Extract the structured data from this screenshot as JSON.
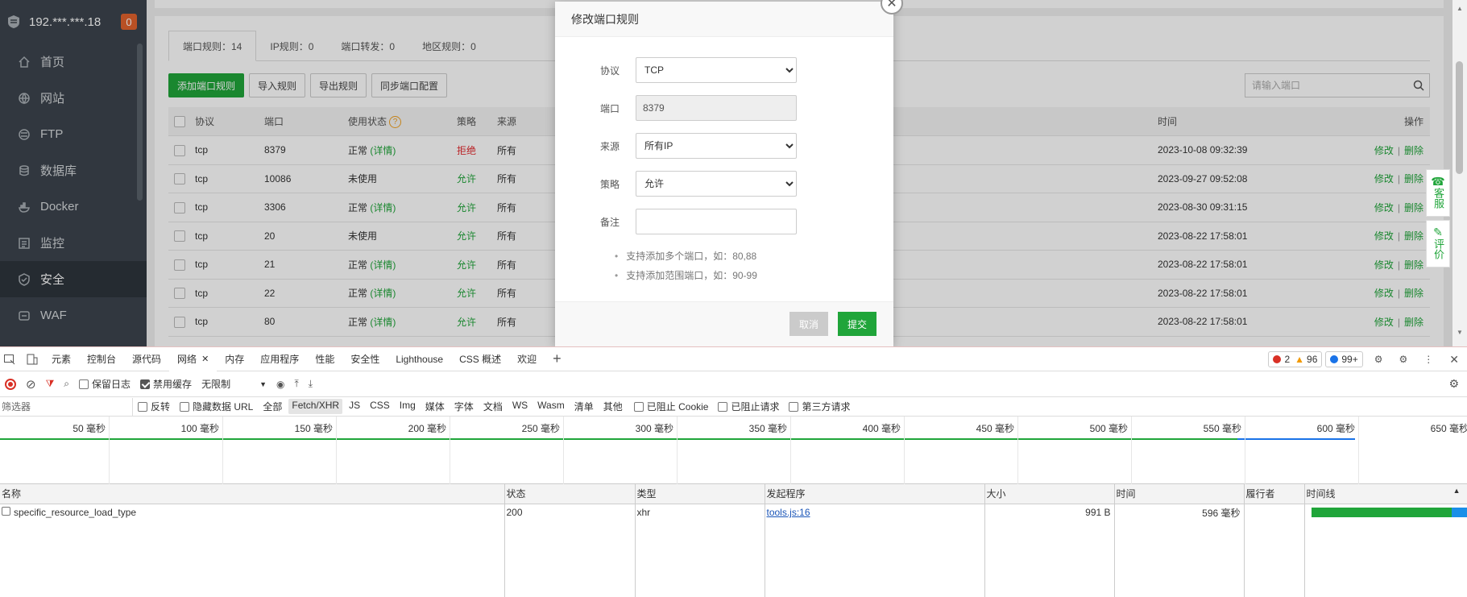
{
  "sidebar": {
    "server_label": "192.***.***.18",
    "badge": "0",
    "items": [
      {
        "label": "首页",
        "icon": "home-icon"
      },
      {
        "label": "网站",
        "icon": "globe-icon"
      },
      {
        "label": "FTP",
        "icon": "ftp-icon"
      },
      {
        "label": "数据库",
        "icon": "database-icon"
      },
      {
        "label": "Docker",
        "icon": "docker-icon"
      },
      {
        "label": "监控",
        "icon": "monitor-icon"
      },
      {
        "label": "安全",
        "icon": "shield-icon"
      },
      {
        "label": "WAF",
        "icon": "waf-icon"
      }
    ]
  },
  "tabs": [
    {
      "label": "端口规则：14"
    },
    {
      "label": "IP规则：0"
    },
    {
      "label": "端口转发：0"
    },
    {
      "label": "地区规则：0"
    }
  ],
  "toolbar": {
    "add_label": "添加端口规则",
    "import_label": "导入规则",
    "export_label": "导出规则",
    "sync_label": "同步端口配置",
    "search_placeholder": "请输入端口"
  },
  "table": {
    "headers": {
      "protocol": "协议",
      "port": "端口",
      "status": "使用状态",
      "policy": "策略",
      "source": "来源",
      "time": "时间",
      "ops": "操作"
    },
    "rows": [
      {
        "protocol": "tcp",
        "port": "8379",
        "status": "正常",
        "detail": "(详情)",
        "policy": "拒绝",
        "source": "所有",
        "time": "2023-10-08 09:32:39"
      },
      {
        "protocol": "tcp",
        "port": "10086",
        "status": "未使用",
        "detail": "",
        "policy": "允许",
        "source": "所有",
        "time": "2023-09-27 09:52:08"
      },
      {
        "protocol": "tcp",
        "port": "3306",
        "status": "正常",
        "detail": "(详情)",
        "policy": "允许",
        "source": "所有",
        "time": "2023-08-30 09:31:15"
      },
      {
        "protocol": "tcp",
        "port": "20",
        "status": "未使用",
        "detail": "",
        "policy": "允许",
        "source": "所有",
        "time": "2023-08-22 17:58:01"
      },
      {
        "protocol": "tcp",
        "port": "21",
        "status": "正常",
        "detail": "(详情)",
        "policy": "允许",
        "source": "所有",
        "time": "2023-08-22 17:58:01"
      },
      {
        "protocol": "tcp",
        "port": "22",
        "status": "正常",
        "detail": "(详情)",
        "policy": "允许",
        "source": "所有",
        "time": "2023-08-22 17:58:01"
      },
      {
        "protocol": "tcp",
        "port": "80",
        "status": "正常",
        "detail": "(详情)",
        "policy": "允许",
        "source": "所有",
        "time": "2023-08-22 17:58:01"
      }
    ],
    "edit_label": "修改",
    "delete_label": "删除",
    "sep": "|"
  },
  "float": {
    "service": "客服",
    "rate": "评价"
  },
  "modal": {
    "title": "修改端口规则",
    "protocol_label": "协议",
    "protocol_value": "TCP",
    "port_label": "端口",
    "port_value": "8379",
    "source_label": "来源",
    "source_value": "所有IP",
    "policy_label": "策略",
    "policy_value": "允许",
    "note_label": "备注",
    "note_value": "",
    "tips": [
      "支持添加多个端口，如：80,88",
      "支持添加范围端口，如：90-99"
    ],
    "cancel_label": "取消",
    "submit_label": "提交"
  },
  "devtools": {
    "tabs": [
      "元素",
      "控制台",
      "源代码",
      "网络",
      "内存",
      "应用程序",
      "性能",
      "安全性",
      "Lighthouse",
      "CSS 概述",
      "欢迎"
    ],
    "active_tab": "网络",
    "errors": "2",
    "warnings": "96",
    "messages": "99+",
    "preserve_log": "保留日志",
    "disable_cache": "禁用缓存",
    "throttle": "无限制",
    "filter_placeholder": "筛选器",
    "invert": "反转",
    "hide_data_url": "隐藏数据 URL",
    "types": [
      "全部",
      "Fetch/XHR",
      "JS",
      "CSS",
      "Img",
      "媒体",
      "字体",
      "文档",
      "WS",
      "Wasm",
      "清单",
      "其他"
    ],
    "active_type": "Fetch/XHR",
    "blocked_cookies": "已阻止 Cookie",
    "blocked_requests": "已阻止请求",
    "third_party": "第三方请求",
    "ticks": [
      "50 毫秒",
      "100 毫秒",
      "150 毫秒",
      "200 毫秒",
      "250 毫秒",
      "300 毫秒",
      "350 毫秒",
      "400 毫秒",
      "450 毫秒",
      "500 毫秒",
      "550 毫秒",
      "600 毫秒",
      "650 毫秒"
    ],
    "columns": {
      "name": "名称",
      "status": "状态",
      "type": "类型",
      "initiator": "发起程序",
      "size": "大小",
      "time": "时间",
      "fulfilled": "履行者",
      "waterfall": "时间线"
    },
    "requests": [
      {
        "name": "specific_resource_load_type",
        "status": "200",
        "type": "xhr",
        "initiator": "tools.js:16",
        "size": "991 B",
        "time": "596 毫秒",
        "fulfilled": ""
      }
    ]
  },
  "colors": {
    "accent": "#20a53a",
    "danger": "#e2292e",
    "sidebar": "#3c444d",
    "badge": "#e2622c"
  }
}
